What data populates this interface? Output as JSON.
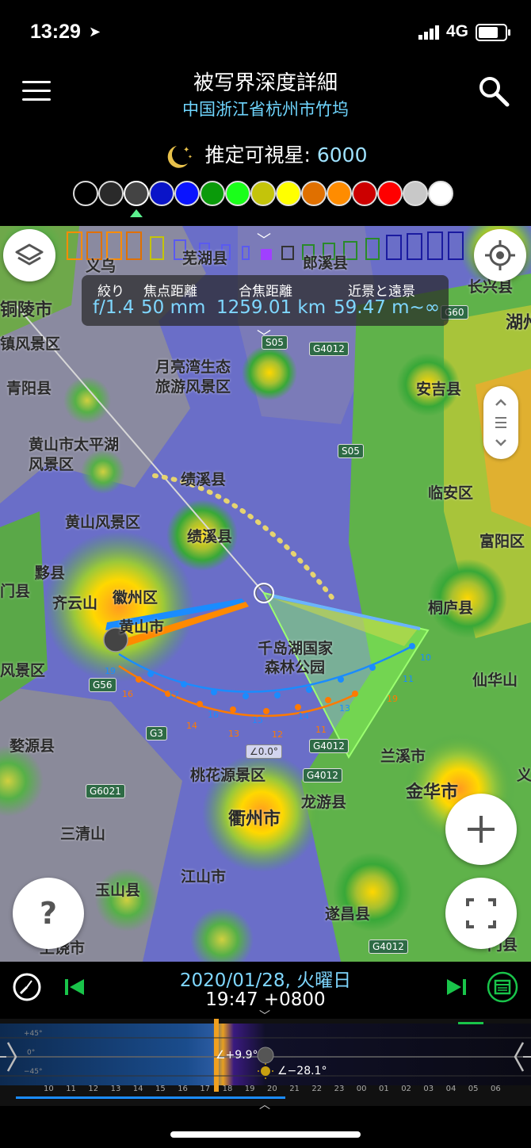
{
  "status_bar": {
    "time": "13:29",
    "network": "4G"
  },
  "header": {
    "title": "被写界深度詳細",
    "subtitle": "中国浙江省杭州市竹坞",
    "visible_stars_label": "推定可視星:",
    "visible_stars_value": "6000"
  },
  "color_swatches": [
    "#000000",
    "#2a2a2a",
    "#444444",
    "#0a14c8",
    "#0a14ff",
    "#0a9a0a",
    "#1aff1a",
    "#c4c40a",
    "#ffff00",
    "#e07000",
    "#ff8c00",
    "#cc0000",
    "#ff0000",
    "#c8c8c8",
    "#ffffff"
  ],
  "info_panel": {
    "aperture_label": "絞り",
    "aperture_value": "f/1.4",
    "focal_label": "焦点距離",
    "focal_value": "50 mm",
    "focus_dist_label": "合焦距離",
    "focus_dist_value": "1259.01 km",
    "near_far_label": "近景と遠景",
    "near_far_value": "59.47 m~∞"
  },
  "map": {
    "labels": [
      "铜陵市",
      "镇风景区",
      "青阳县",
      "黄山市太平湖",
      "风景区",
      "月亮湾生态",
      "旅游风景区",
      "黄山风景区",
      "绩溪县",
      "黟县",
      "齐云山",
      "徽州区",
      "黄山市",
      "千岛湖国家",
      "森林公园",
      "桐庐县",
      "安吉县",
      "临安区",
      "富阳区",
      "仙华山",
      "兰溪市",
      "金华市",
      "婺源县",
      "桃花源景区",
      "衢州市",
      "龙游县",
      "三清山",
      "江山市",
      "玉山县",
      "遂昌县",
      "上饶市",
      "长兴县",
      "湖州",
      "芜湖县",
      "郎溪县",
      "繁昌县",
      "门县",
      "义乌",
      "风景区"
    ],
    "roads": [
      "G4012",
      "S05",
      "S05",
      "G56",
      "G3",
      "G4012",
      "G4012",
      "G6021",
      "G4012",
      "G60",
      "S01"
    ],
    "angle_label": "∠0.0°",
    "sun_hours": [
      "19",
      "17",
      "16",
      "15",
      "14",
      "13",
      "12",
      "11",
      "10",
      "11"
    ],
    "moon_hours": [
      "16",
      "17",
      "16",
      "15",
      "14",
      "13",
      "12",
      "11"
    ]
  },
  "timeline": {
    "date": "2020/01/28, 火曜日",
    "time": "19:47 +0800",
    "hours": [
      "10",
      "11",
      "12",
      "13",
      "14",
      "15",
      "16",
      "17",
      "18",
      "19",
      "20",
      "21",
      "22",
      "23",
      "00",
      "01",
      "02",
      "03",
      "04",
      "05",
      "06"
    ],
    "moon_alt": "∠+9.9°",
    "sun_alt": "∠−28.1°",
    "left_marks": [
      "+45°",
      "0°",
      "−45°"
    ]
  },
  "colors": {
    "accent": "#6fd6ff",
    "green": "#19c44a",
    "sun_line": "#ff8a00",
    "moon_line": "#1a8cff"
  }
}
